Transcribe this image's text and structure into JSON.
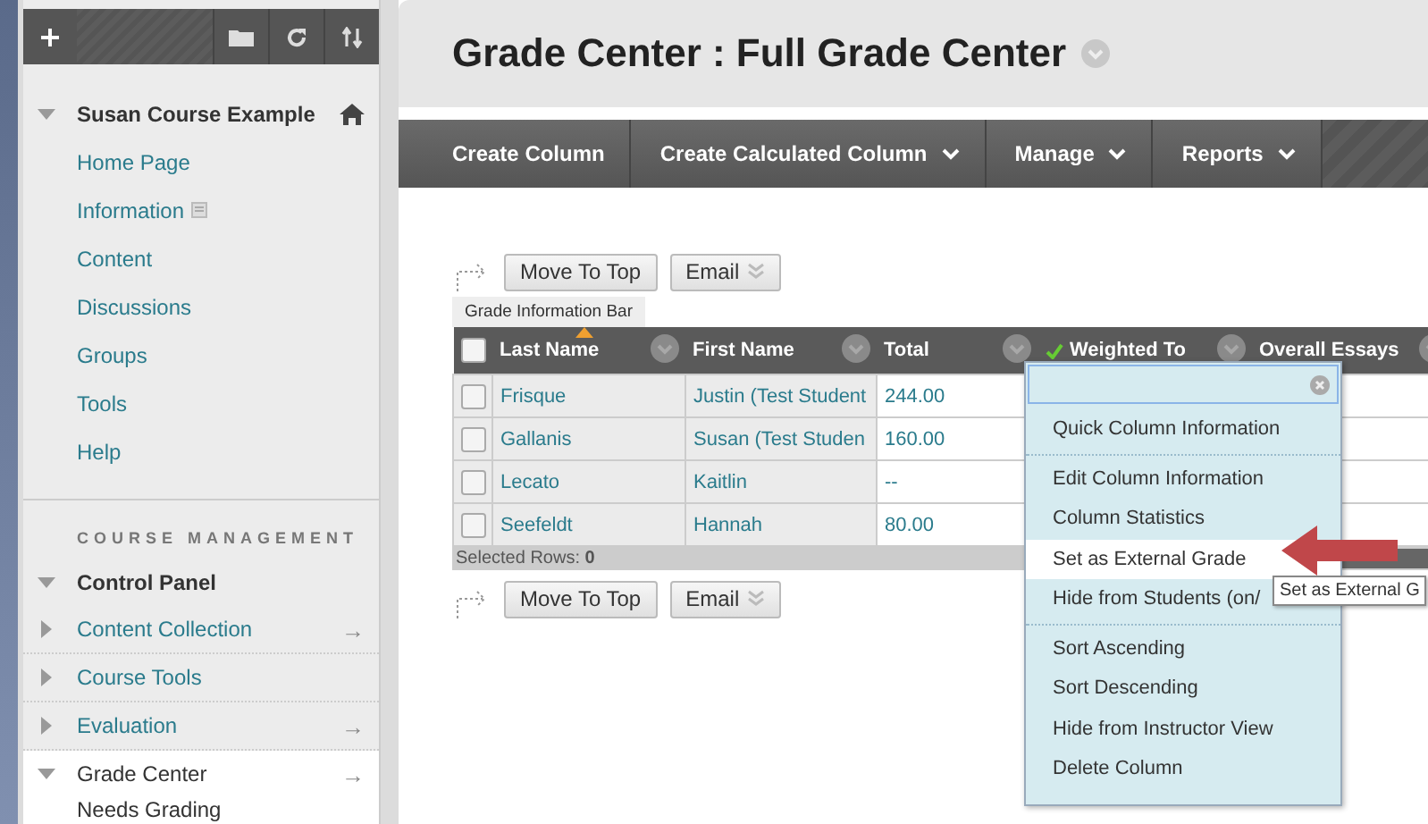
{
  "sidebar": {
    "course": {
      "title": "Susan Course Example",
      "expanded": true,
      "items": [
        {
          "label": "Home Page",
          "info_icon": false
        },
        {
          "label": "Information",
          "info_icon": true
        },
        {
          "label": "Content",
          "info_icon": false
        },
        {
          "label": "Discussions",
          "info_icon": false
        },
        {
          "label": "Groups",
          "info_icon": false
        },
        {
          "label": "Tools",
          "info_icon": false
        },
        {
          "label": "Help",
          "info_icon": false
        }
      ]
    },
    "section_heading": "COURSE MANAGEMENT",
    "control_panel": {
      "title": "Control Panel",
      "expanded": true,
      "items": [
        {
          "label": "Content Collection",
          "expanded": false,
          "selected": false,
          "arrow": "→"
        },
        {
          "label": "Course Tools",
          "expanded": false,
          "selected": false
        },
        {
          "label": "Evaluation",
          "expanded": false,
          "selected": false,
          "arrow": "→"
        },
        {
          "label": "Grade Center",
          "expanded": true,
          "selected": true,
          "arrow": "→",
          "children": [
            {
              "label": "Needs Grading"
            }
          ]
        }
      ]
    }
  },
  "page": {
    "title": "Grade Center : Full Grade Center",
    "nav": [
      {
        "label": "Create Column",
        "dropdown": false
      },
      {
        "label": "Create Calculated Column",
        "dropdown": true
      },
      {
        "label": "Manage",
        "dropdown": true
      },
      {
        "label": "Reports",
        "dropdown": true
      }
    ],
    "actions": [
      "Move To Top",
      "Email"
    ],
    "info_bar_tab": "Grade Information Bar",
    "select_all_checked": false,
    "columns": [
      {
        "label": "Last Name",
        "sorted": true,
        "checkmark": false
      },
      {
        "label": "First Name",
        "sorted": false,
        "checkmark": false
      },
      {
        "label": "Total",
        "sorted": false,
        "checkmark": false
      },
      {
        "label": "Weighted To",
        "sorted": false,
        "checkmark": true
      },
      {
        "label": "Overall Essays",
        "sorted": false,
        "checkmark": false
      }
    ],
    "rows": [
      {
        "checked": false,
        "last_name": "Frisque",
        "first_name": "Justin (Test Student",
        "total": "244.00"
      },
      {
        "checked": false,
        "last_name": "Gallanis",
        "first_name": "Susan (Test Studen",
        "total": "160.00"
      },
      {
        "checked": false,
        "last_name": "Lecato",
        "first_name": "Kaitlin",
        "total": "--"
      },
      {
        "checked": false,
        "last_name": "Seefeldt",
        "first_name": "Hannah",
        "total": "80.00"
      }
    ],
    "selected_rows": "Selected Rows: **0**",
    "bottom_actions": [
      "Move To Top",
      "Email"
    ]
  },
  "column_menu": {
    "groups": [
      [
        {
          "label": "Quick Column Information",
          "selected": false
        }
      ],
      [
        {
          "label": "Edit Column Information",
          "selected": false
        },
        {
          "label": "Column Statistics",
          "selected": false
        },
        {
          "label": "Set as External Grade",
          "selected": true
        },
        {
          "label": "Hide from Students (on/",
          "selected": false
        }
      ],
      [
        {
          "label": "Sort Ascending",
          "selected": false
        },
        {
          "label": "Sort Descending",
          "selected": false
        },
        {
          "label": "Hide from Instructor View",
          "selected": false
        },
        {
          "label": "Delete Column",
          "selected": false
        }
      ]
    ]
  },
  "tooltip": "Set as External G"
}
